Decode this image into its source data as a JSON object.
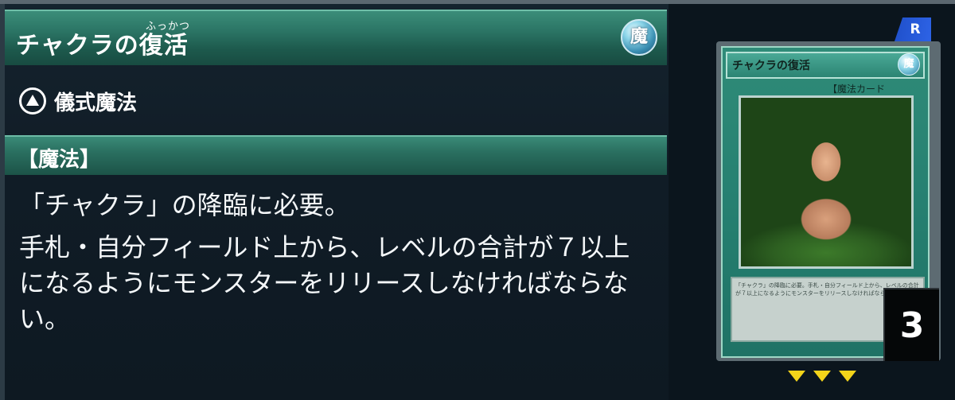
{
  "title_panel": {
    "ruby": "ふっかつ",
    "name": "チャクラの復活",
    "attribute_badge": "魔"
  },
  "card_type": {
    "icon": "ritual-spell-icon",
    "label": "儀式魔法"
  },
  "category_bar": {
    "label": "【魔法】"
  },
  "effect": {
    "line1": "「チャクラ」の降臨に必要。",
    "line2": "手札・自分フィールド上から、レベルの合計が７以上になるようにモンスターをリリースしなければならない。"
  },
  "card_preview": {
    "rarity": "R",
    "name": "チャクラの復活",
    "attribute_badge": "魔",
    "type_line": "【魔法カード",
    "text": "「チャクラ」の降臨に必要。手札・自分フィールド上から、レベルの合計が７以上になるようにモンスターをリリースしなければならない。",
    "count": "3",
    "colors": {
      "frame": "#268071",
      "rarity": "#2d63e6",
      "arrows": "#f3d41a"
    }
  }
}
